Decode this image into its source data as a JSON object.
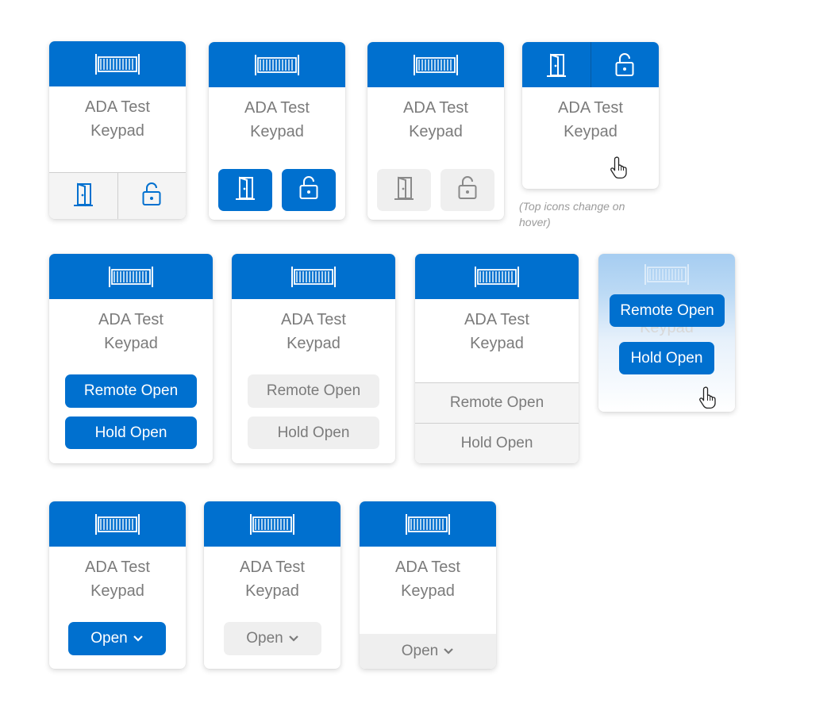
{
  "keypad": {
    "name_line1": "ADA Test",
    "name_line2": "Keypad"
  },
  "hover_note": "(Top icons change on hover)",
  "actions": {
    "remote_open": "Remote Open",
    "hold_open": "Hold Open",
    "open": "Open"
  },
  "icons": {
    "gate": "gate-icon",
    "door": "door-icon",
    "lock": "unlock-icon",
    "chevron": "chevron-down-icon",
    "cursor": "hand-cursor-icon"
  },
  "colors": {
    "brand_blue": "#0070cf",
    "muted_text": "#7b7b7b",
    "disabled_bg": "#efefef"
  }
}
